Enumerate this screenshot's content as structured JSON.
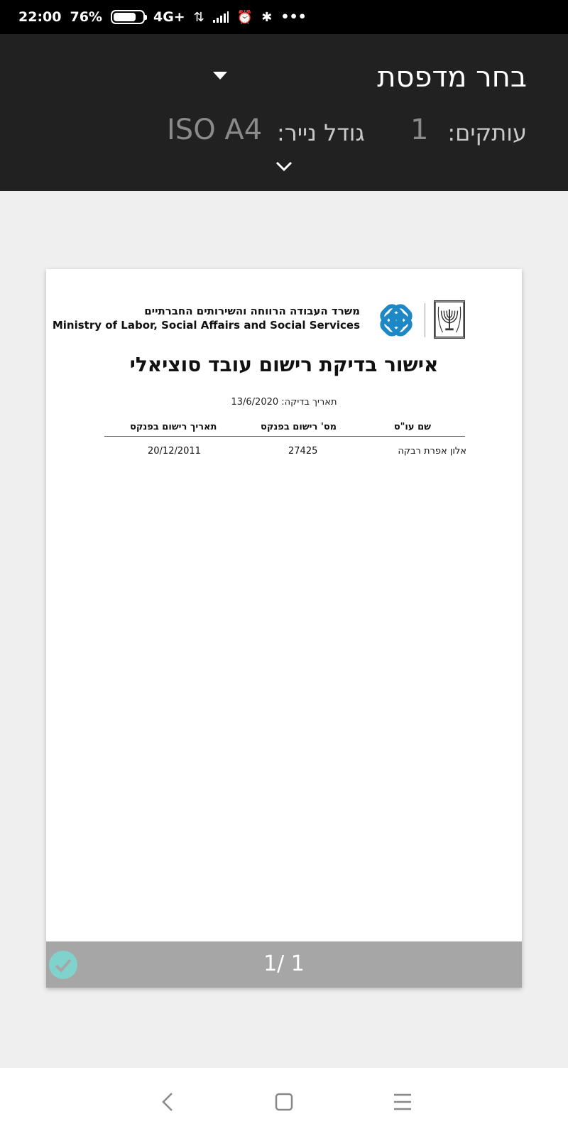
{
  "status_bar": {
    "time": "22:00",
    "battery": "76%",
    "network": "4G+",
    "battery_level": 0.76,
    "icons": [
      "battery-icon",
      "data-transfer-icon",
      "signal-icon",
      "alarm-icon",
      "bluetooth-icon",
      "more-icon"
    ]
  },
  "print_header": {
    "printer_title": "בחר מדפסת",
    "copies_label": "עותקים:",
    "copies_value": "1",
    "paper_label": "גודל נייר:",
    "paper_value": "ISO A4"
  },
  "document": {
    "ministry_he": "משרד העבודה הרווחה והשירותים החברתיים",
    "ministry_en": "Ministry of Labor, Social Affairs and Social Services",
    "title": "אישור בדיקת רישום עובד סוציאלי",
    "check_date": "תאריך בדיקה: 13/6/2020",
    "table": {
      "headers": [
        "שם עו\"ס",
        "מס' רישום בפנקס",
        "תאריך רישום בפנקס"
      ],
      "rows": [
        [
          "אלון אפרת רבקה",
          "27425",
          "20/12/2011"
        ]
      ]
    }
  },
  "page_indicator": "1/ 1",
  "colors": {
    "header_bg": "#212121",
    "accent_check": "#7fd3cc",
    "logo_blue": "#1e88c7"
  }
}
